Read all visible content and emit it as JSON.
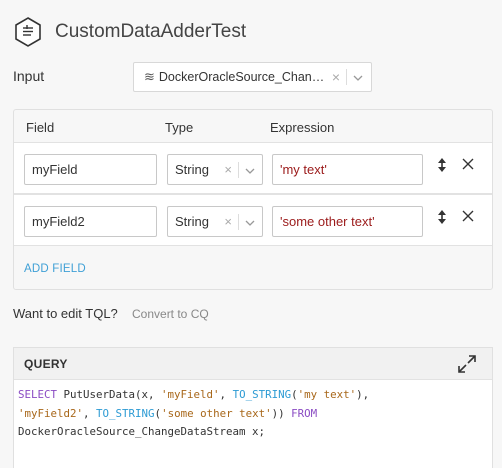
{
  "header": {
    "title": "CustomDataAdderTest",
    "icon": "component-hex-icon"
  },
  "input": {
    "label": "Input",
    "value": "DockerOracleSource_Change…"
  },
  "fields": {
    "headers": {
      "field": "Field",
      "type": "Type",
      "expression": "Expression"
    },
    "rows": [
      {
        "name": "myField",
        "type": "String",
        "expression": "'my text'"
      },
      {
        "name": "myField2",
        "type": "String",
        "expression": "'some other text'"
      }
    ],
    "add_label": "ADD FIELD"
  },
  "tql": {
    "question": "Want to edit TQL?",
    "link": "Convert to CQ"
  },
  "query": {
    "title": "QUERY",
    "lines": [
      [
        {
          "t": "kw",
          "v": "SELECT"
        },
        {
          "t": "p",
          "v": " PutUserData(x, "
        },
        {
          "t": "str",
          "v": "'myField'"
        },
        {
          "t": "p",
          "v": ", "
        },
        {
          "t": "fn",
          "v": "TO_STRING"
        },
        {
          "t": "p",
          "v": "("
        },
        {
          "t": "str",
          "v": "'my text'"
        },
        {
          "t": "p",
          "v": "),"
        }
      ],
      [
        {
          "t": "str",
          "v": "'myField2'"
        },
        {
          "t": "p",
          "v": ", "
        },
        {
          "t": "fn",
          "v": "TO_STRING"
        },
        {
          "t": "p",
          "v": "("
        },
        {
          "t": "str",
          "v": "'some other text'"
        },
        {
          "t": "p",
          "v": ")) "
        },
        {
          "t": "kw",
          "v": "FROM"
        }
      ],
      [
        {
          "t": "p",
          "v": "DockerOracleSource_ChangeDataStream x;"
        }
      ]
    ]
  }
}
